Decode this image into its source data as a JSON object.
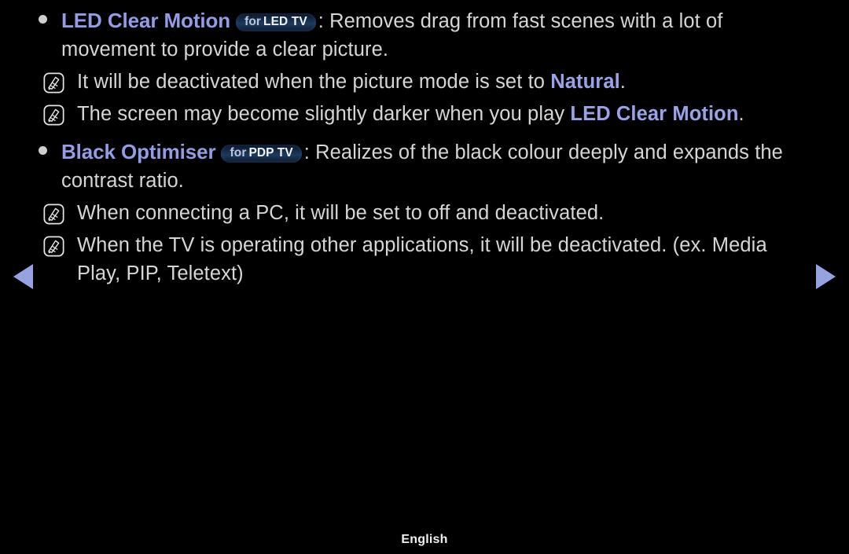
{
  "page": {
    "background_color": "#000000",
    "body_text_color": "#d6d6d6",
    "accent_color": "#949ce6",
    "badge_text_color": "#f2f4f8"
  },
  "sections": [
    {
      "bullet": "•",
      "title": "LED Clear Motion",
      "badge": {
        "prefix": "for",
        "main": "LED TV"
      },
      "colon": ":",
      "body": " Removes drag from fast scenes with a lot of movement to provide a clear picture.",
      "notes": [
        {
          "icon": "note-pencil-icon",
          "pre": "It will be deactivated when the picture mode is set to ",
          "highlight": "Natural",
          "post": "."
        },
        {
          "icon": "note-pencil-icon",
          "pre": "The screen may become slightly darker when you play ",
          "highlight": "LED Clear Motion",
          "post": "."
        }
      ]
    },
    {
      "bullet": "•",
      "title": "Black Optimiser",
      "badge": {
        "prefix": "for",
        "main": "PDP TV"
      },
      "colon": ":",
      "body": " Realizes of the black colour deeply and expands the contrast ratio.",
      "notes": [
        {
          "icon": "note-pencil-icon",
          "pre": "When connecting a PC, it will be set to off and deactivated.",
          "highlight": "",
          "post": ""
        },
        {
          "icon": "note-pencil-icon",
          "pre": "When the TV is operating other applications, it will be deactivated. (ex. Media Play, PIP, Teletext)",
          "highlight": "",
          "post": ""
        }
      ]
    }
  ],
  "nav": {
    "prev_label": "previous-page",
    "next_label": "next-page"
  },
  "footer": {
    "language": "English"
  }
}
